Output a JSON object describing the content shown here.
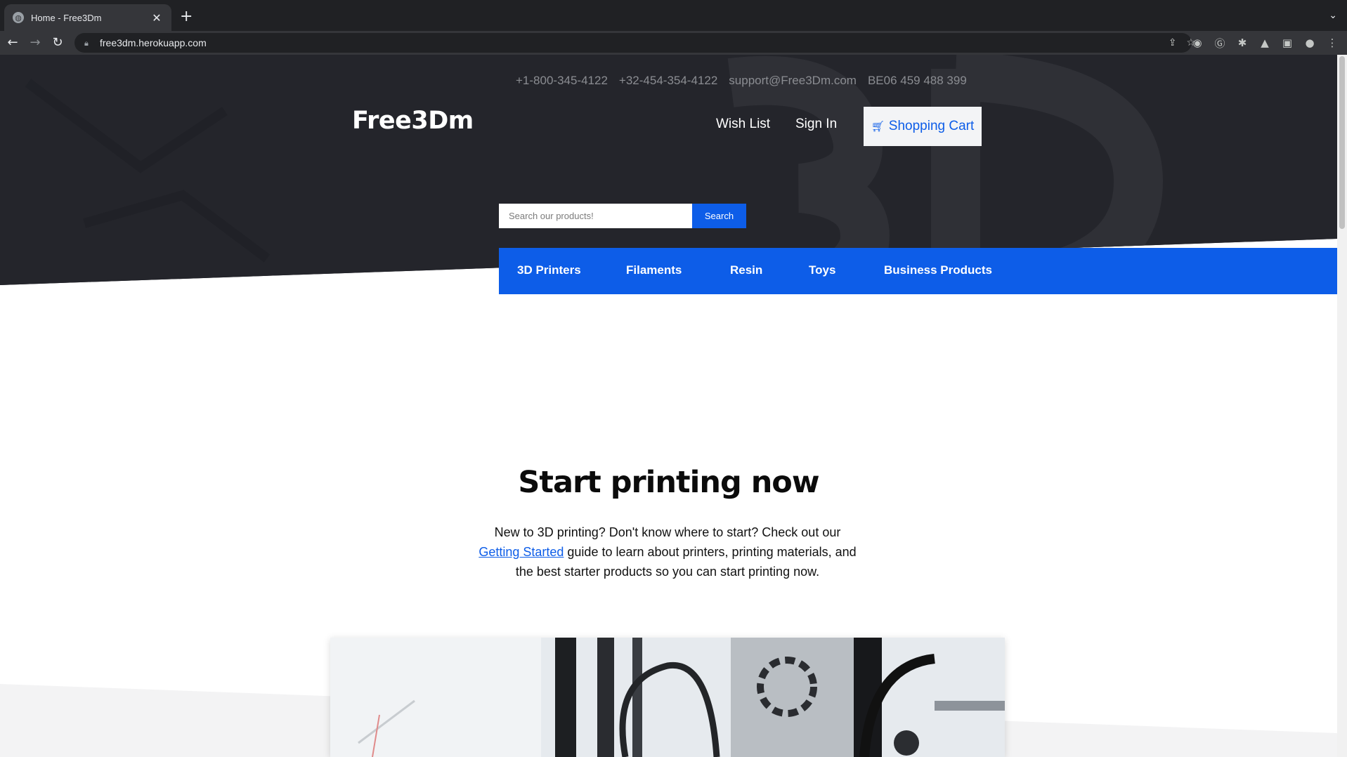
{
  "browser": {
    "tab_title": "Home - Free3Dm",
    "url": "free3dm.herokuapp.com",
    "icons": [
      "globe-icon",
      "close-icon",
      "plus-icon",
      "back-icon",
      "forward-icon",
      "reload-icon",
      "lock-icon",
      "share-icon",
      "star-icon",
      "camera-icon",
      "grammarly-icon",
      "extensions-icon",
      "flask-icon",
      "sidebar-icon",
      "profile-icon",
      "menu-icon"
    ]
  },
  "header": {
    "contacts": [
      "+1-800-345-4122",
      "+32-454-354-4122",
      "support@Free3Dm.com",
      "BE06 459 488 399"
    ],
    "logo": "Free3Dm",
    "wish_list": "Wish List",
    "sign_in": "Sign In",
    "cart": "Shopping Cart"
  },
  "search": {
    "placeholder": "Search our products!",
    "button": "Search"
  },
  "categories": [
    "3D Printers",
    "Filaments",
    "Resin",
    "Toys",
    "Business Products"
  ],
  "main": {
    "headline": "Start printing now",
    "intro_before": "New to 3D printing? Don't know where to start? Check out our ",
    "intro_link": "Getting Started",
    "intro_after": " guide to learn about printers, printing materials, and the best starter products so you can start printing now."
  },
  "colors": {
    "accent": "#0d5de8",
    "hero": "#24252b",
    "chrome": "#202124"
  }
}
